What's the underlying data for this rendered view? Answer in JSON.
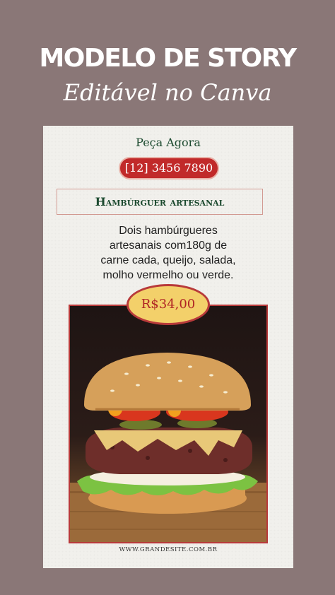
{
  "header": {
    "headline": "MODELO DE STORY",
    "subheadline": "Editável no Canva"
  },
  "card": {
    "order_label": "Peça Agora",
    "phone": "[12] 3456 7890",
    "product_title": "Hambúrguer artesanal",
    "description_lines": [
      "Dois hambúrgueres",
      "artesanais com180g de",
      "carne cada, queijo, salada,",
      "molho vermelho ou verde."
    ],
    "price": "R$34,00",
    "website": "WWW.GRANDESITE.COM.BR"
  },
  "colors": {
    "background": "#8a7777",
    "card": "#f1f0ec",
    "accent_red": "#c12a2a",
    "accent_green": "#1c4a2f",
    "price_badge": "#f3d06a"
  }
}
